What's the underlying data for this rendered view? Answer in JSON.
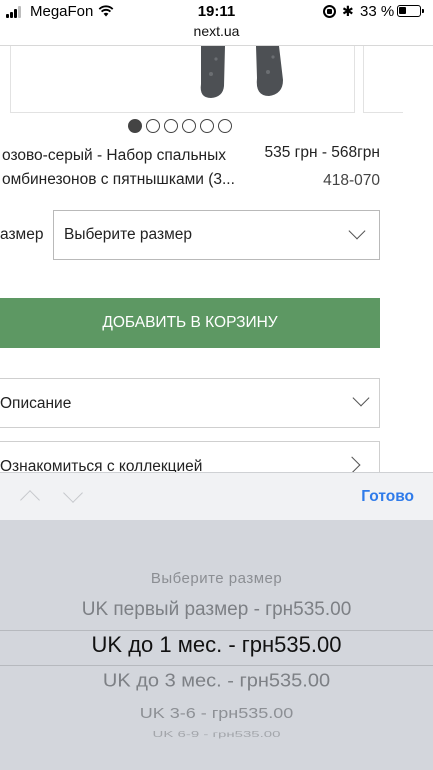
{
  "status_bar": {
    "carrier": "MegaFon",
    "time": "19:11",
    "url": "next.ua",
    "battery_percent": "33 %"
  },
  "product": {
    "title": "озово-серый - Набор спальных омбинезонов с пятнышками (3...",
    "price": "535 грн - 568грн",
    "sku": "418-070",
    "gallery": {
      "count": 6,
      "active_index": 0
    }
  },
  "size": {
    "label": "азмер",
    "placeholder": "Выберите размер"
  },
  "add_to_cart_label": "ДОБАВИТЬ В КОРЗИНУ",
  "accordion": [
    {
      "label": "Описание"
    },
    {
      "label": "Ознакомиться с коллекцией"
    }
  ],
  "toolbar": {
    "done_label": "Готово"
  },
  "picker": {
    "options": [
      "Выберите размер",
      "UK первый размер - грн535.00",
      "UK до 1 мес. - грн535.00",
      "UK до 3 мес. - грн535.00",
      "UK 3-6 - грн535.00",
      "UK 6-9 - грн535.00"
    ],
    "selected": "UK до 1 мес. - грн535.00"
  },
  "colors": {
    "add_button": "#5d9863",
    "done_link": "#2f7bea",
    "picker_bg": "#d3d6dc"
  }
}
